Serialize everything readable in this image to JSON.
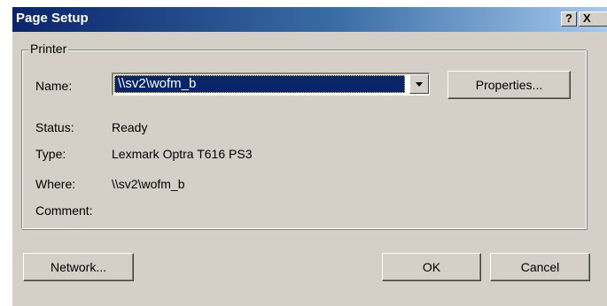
{
  "window": {
    "title": "Page Setup",
    "help_label": "?",
    "close_label": "X"
  },
  "printer_group": {
    "label": "Printer",
    "name_label": "Name:",
    "name_value": "\\\\sv2\\wofm_b",
    "properties_label": "Properties...",
    "status_label": "Status:",
    "status_value": "Ready",
    "type_label": "Type:",
    "type_value": "Lexmark Optra T616 PS3",
    "where_label": "Where:",
    "where_value": "\\\\sv2\\wofm_b",
    "comment_label": "Comment:",
    "comment_value": ""
  },
  "buttons": {
    "network": "Network...",
    "ok": "OK",
    "cancel": "Cancel"
  },
  "colors": {
    "titlebar_start": "#0a246a",
    "titlebar_end": "#a6caf0",
    "dialog_face": "#d4d0c8",
    "selection": "#0a246a"
  }
}
